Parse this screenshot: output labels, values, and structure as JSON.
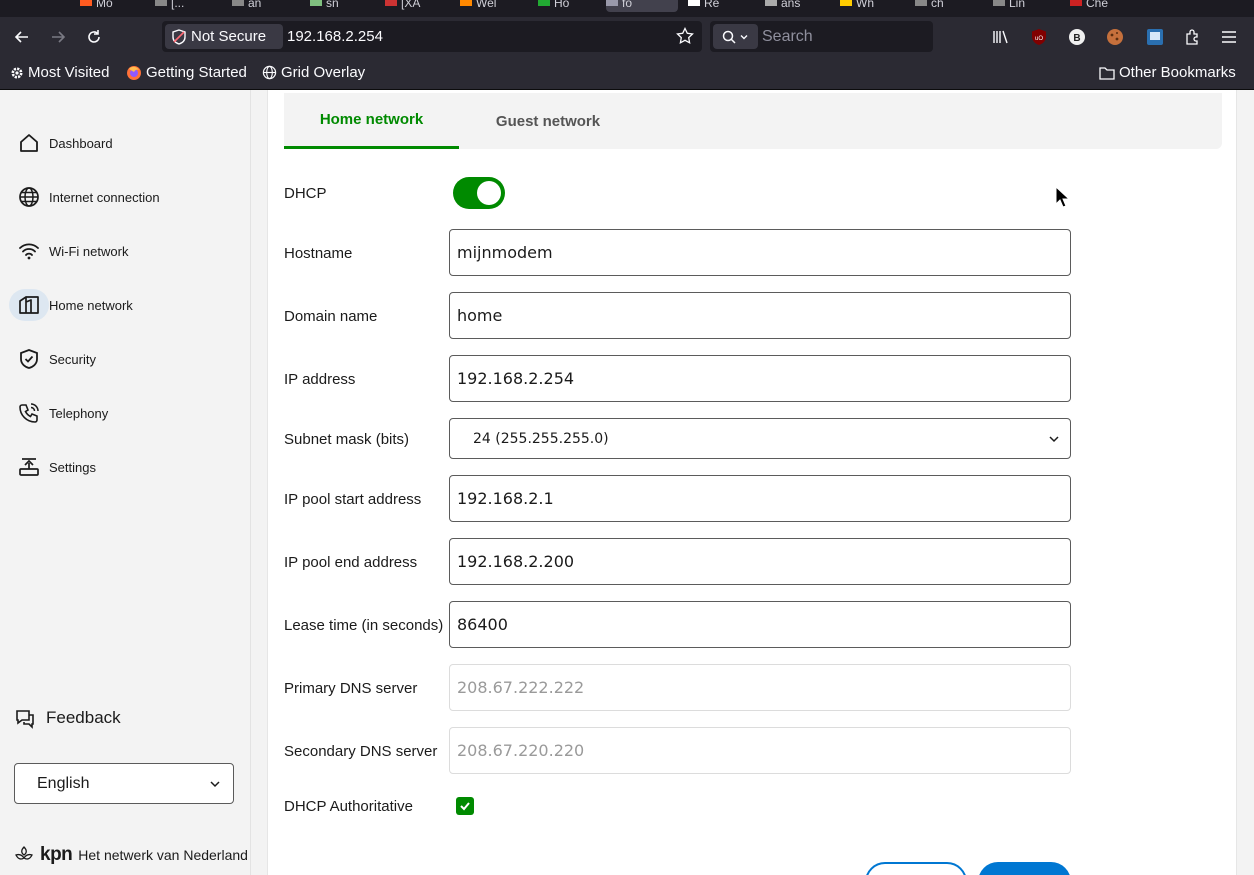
{
  "browser": {
    "tabs": [
      {
        "label": "Mo",
        "color": "#ff5b20"
      },
      {
        "label": "[...",
        "color": "#888888"
      },
      {
        "label": "an",
        "color": "#888888"
      },
      {
        "label": "sn",
        "color": "#7fbf7f"
      },
      {
        "label": "[XA",
        "color": "#cc3333"
      },
      {
        "label": "Wel",
        "color": "#ff8800"
      },
      {
        "label": "Ho",
        "color": "#22aa33"
      },
      {
        "label": "fo",
        "color": "#9999aa"
      },
      {
        "label": "Re",
        "color": "#ffffff"
      },
      {
        "label": "ans",
        "color": "#aaaaaa"
      },
      {
        "label": "Wh",
        "color": "#ffcc00"
      },
      {
        "label": "ch",
        "color": "#888888"
      },
      {
        "label": "Lin",
        "color": "#888888"
      },
      {
        "label": "Che",
        "color": "#cc2222"
      }
    ],
    "url_security": "Not Secure",
    "url": "192.168.2.254",
    "search_placeholder": "Search",
    "bookmarks": {
      "most_visited": "Most Visited",
      "getting_started": "Getting Started",
      "grid_overlay": "Grid Overlay",
      "other_bookmarks": "Other Bookmarks"
    }
  },
  "sidebar": {
    "items": [
      {
        "label": "Dashboard",
        "icon": "home-icon"
      },
      {
        "label": "Internet connection",
        "icon": "globe-icon"
      },
      {
        "label": "Wi-Fi network",
        "icon": "wifi-icon"
      },
      {
        "label": "Home network",
        "icon": "network-icon",
        "active": true
      },
      {
        "label": "Security",
        "icon": "shield-icon"
      },
      {
        "label": "Telephony",
        "icon": "phone-icon"
      },
      {
        "label": "Settings",
        "icon": "settings-icon"
      }
    ],
    "feedback": "Feedback",
    "language": "English",
    "brand": "kpn",
    "tagline": "Het netwerk van Nederland"
  },
  "main": {
    "tabs": [
      {
        "label": "Home network",
        "active": true
      },
      {
        "label": "Guest network",
        "active": false
      }
    ],
    "form": {
      "dhcp_label": "DHCP",
      "dhcp_enabled": true,
      "hostname_label": "Hostname",
      "hostname_value": "mijnmodem",
      "domain_label": "Domain name",
      "domain_value": "home",
      "ip_label": "IP address",
      "ip_value": "192.168.2.254",
      "subnet_label": "Subnet mask (bits)",
      "subnet_value": "24 (255.255.255.0)",
      "pool_start_label": "IP pool start address",
      "pool_start_value": "192.168.2.1",
      "pool_end_label": "IP pool end address",
      "pool_end_value": "192.168.2.200",
      "lease_label": "Lease time (in seconds)",
      "lease_value": "86400",
      "dns1_label": "Primary DNS server",
      "dns1_placeholder": "208.67.222.222",
      "dns2_label": "Secondary DNS server",
      "dns2_placeholder": "208.67.220.220",
      "authoritative_label": "DHCP Authoritative",
      "authoritative_checked": true
    }
  },
  "colors": {
    "accent_green": "#008a00",
    "accent_blue": "#0077d2",
    "active_nav_bg": "#dde7f1"
  }
}
